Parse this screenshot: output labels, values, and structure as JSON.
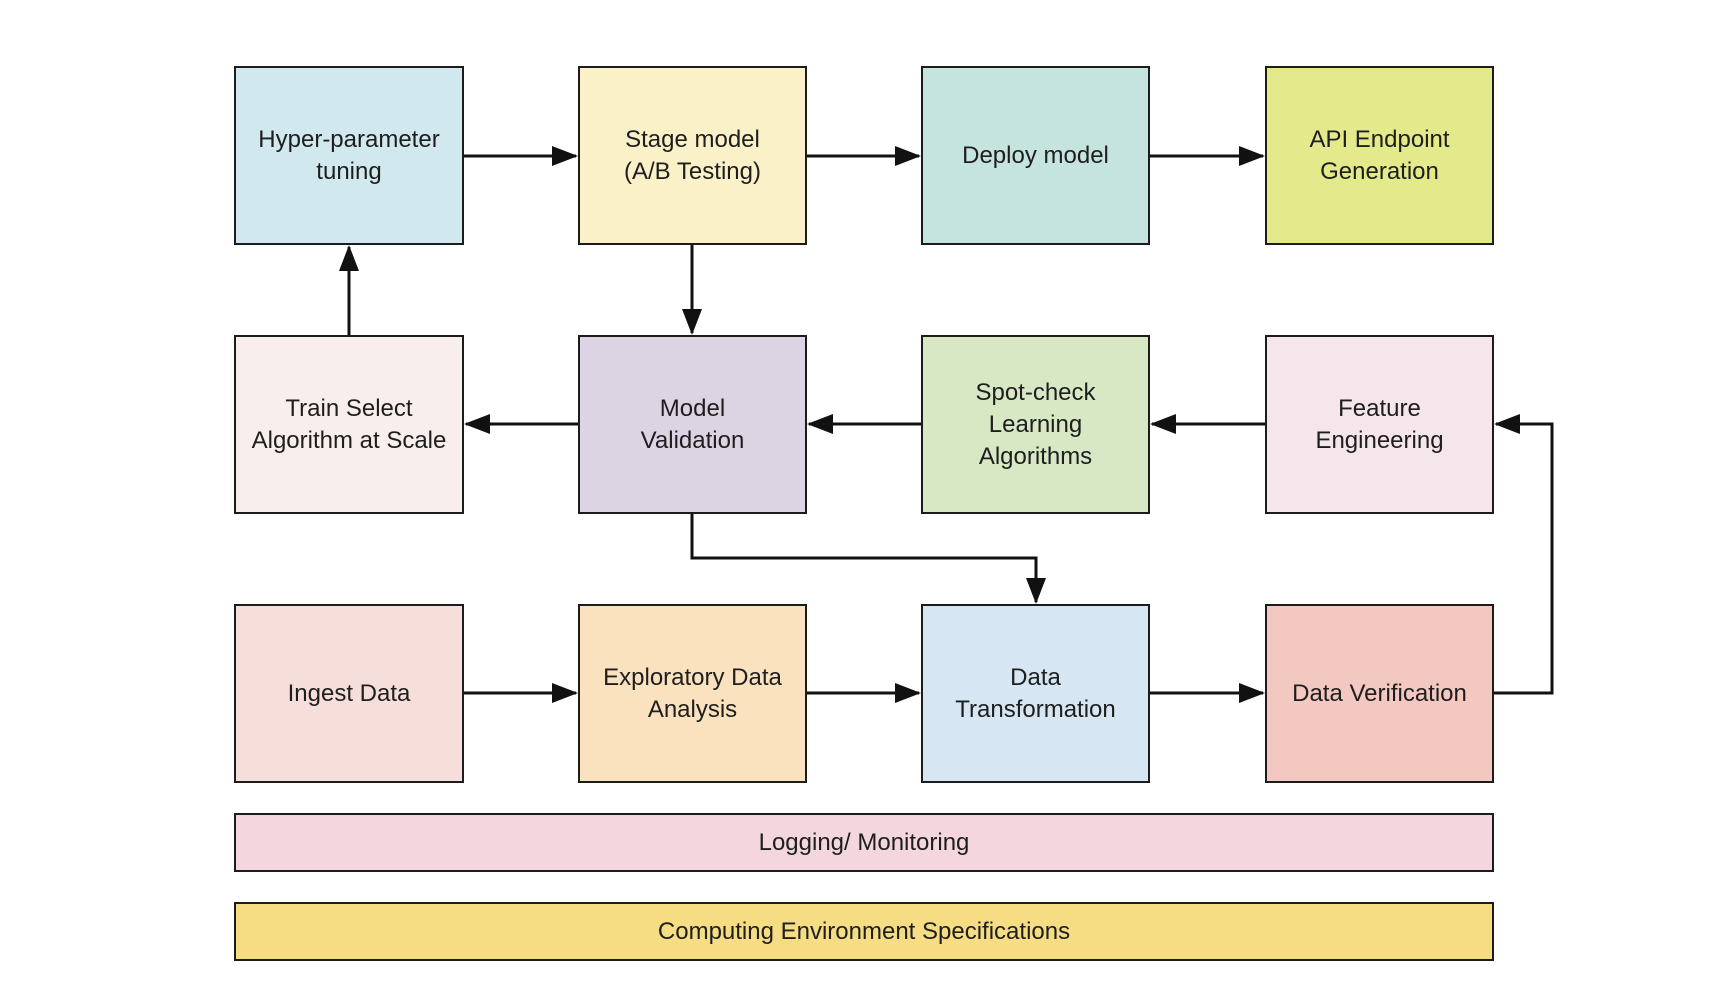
{
  "nodes": {
    "hyper": {
      "label": "Hyper-parameter\ntuning",
      "color": "#d1e8ee"
    },
    "stage": {
      "label": "Stage model\n(A/B Testing)",
      "color": "#fbf1c8"
    },
    "deploy": {
      "label": "Deploy model",
      "color": "#c5e4de"
    },
    "api": {
      "label": "API Endpoint\nGeneration",
      "color": "#e4ea8c"
    },
    "train": {
      "label": "Train Select\nAlgorithm at Scale",
      "color": "#f8eeec"
    },
    "validation": {
      "label": "Model\nValidation",
      "color": "#ddd4e3"
    },
    "spotcheck": {
      "label": "Spot-check\nLearning\nAlgorithms",
      "color": "#d8e8c5"
    },
    "feature": {
      "label": "Feature\nEngineering",
      "color": "#f5e6ec"
    },
    "ingest": {
      "label": "Ingest Data",
      "color": "#f6dedb"
    },
    "eda": {
      "label": "Exploratory Data\nAnalysis",
      "color": "#f9e2bd"
    },
    "transform": {
      "label": "Data\nTransformation",
      "color": "#d6e7f3"
    },
    "verify": {
      "label": "Data Verification",
      "color": "#f2c8c0"
    }
  },
  "bars": {
    "logging": {
      "label": "Logging/ Monitoring",
      "color": "#f4d6de"
    },
    "computing": {
      "label": "Computing Environment Specifications",
      "color": "#f6dd84"
    }
  },
  "edges": [
    {
      "from": "ingest",
      "to": "eda"
    },
    {
      "from": "eda",
      "to": "transform"
    },
    {
      "from": "transform",
      "to": "verify"
    },
    {
      "from": "verify",
      "to": "feature"
    },
    {
      "from": "feature",
      "to": "spotcheck"
    },
    {
      "from": "spotcheck",
      "to": "validation"
    },
    {
      "from": "validation",
      "to": "train"
    },
    {
      "from": "validation",
      "to": "transform"
    },
    {
      "from": "train",
      "to": "hyper"
    },
    {
      "from": "hyper",
      "to": "stage"
    },
    {
      "from": "stage",
      "to": "validation"
    },
    {
      "from": "stage",
      "to": "deploy"
    },
    {
      "from": "deploy",
      "to": "api"
    }
  ]
}
